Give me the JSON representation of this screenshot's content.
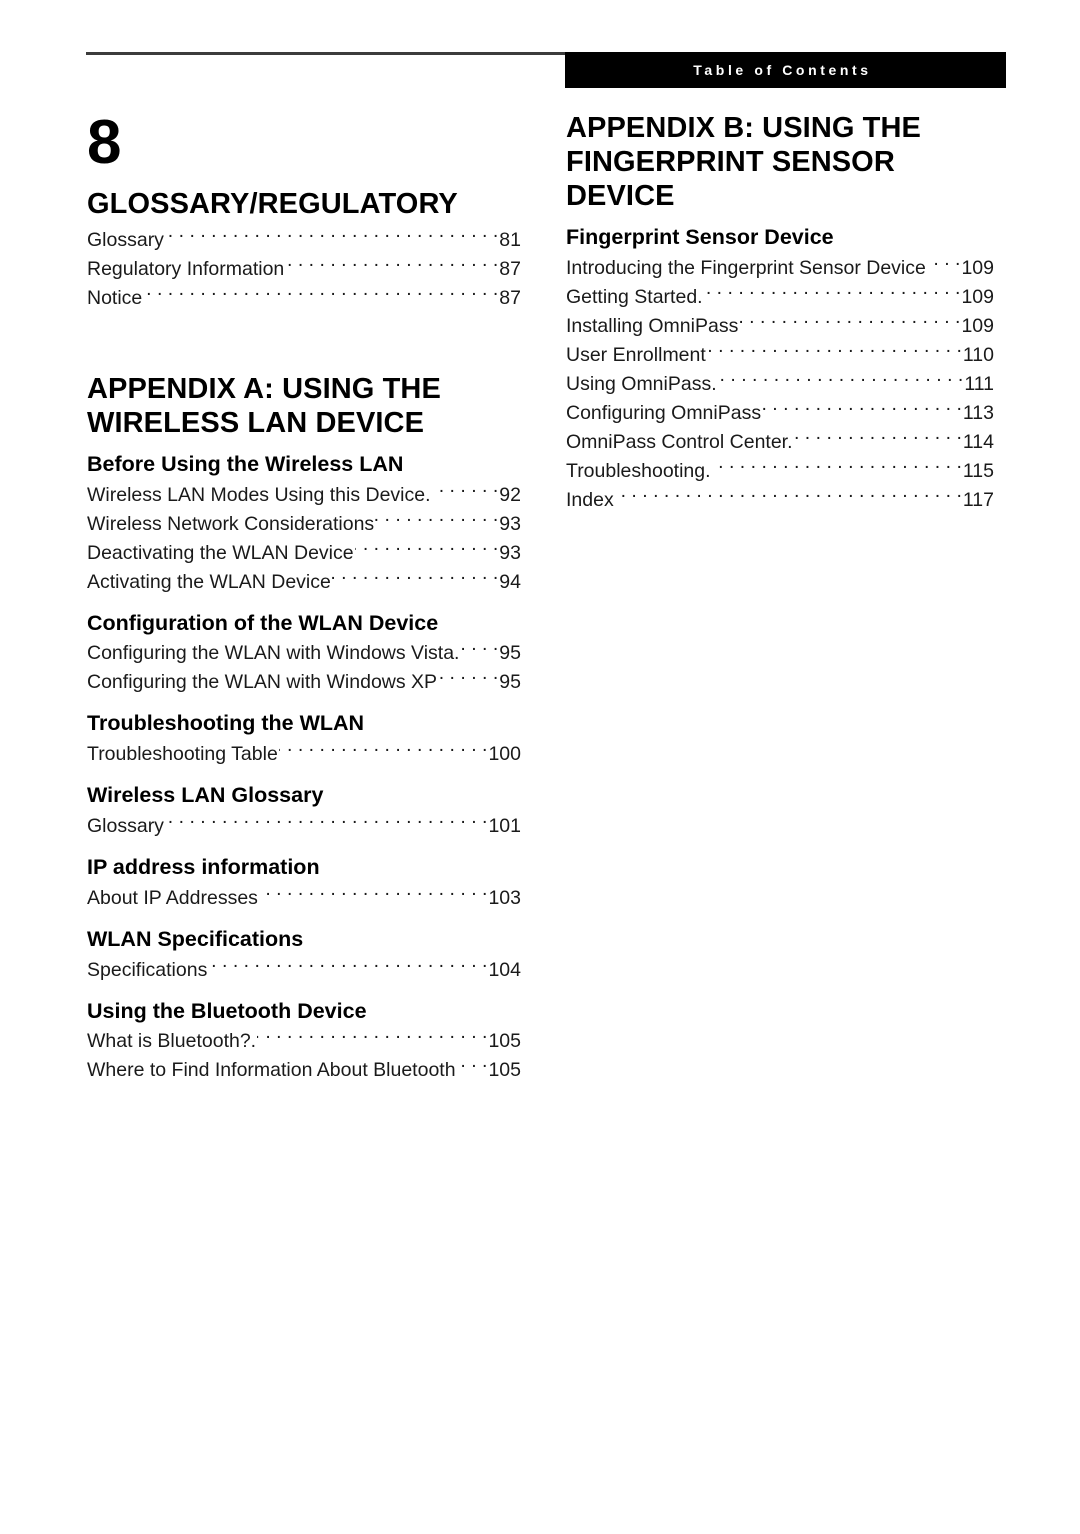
{
  "header": {
    "running_head": "Table of Contents"
  },
  "left_column": {
    "chapter_number": "8",
    "part_title": "GLOSSARY/REGULATORY",
    "entries": [
      {
        "label": "Glossary",
        "page": "81"
      },
      {
        "label": "Regulatory Information",
        "page": "87"
      },
      {
        "label": "Notice",
        "page": "87"
      }
    ],
    "appendix_a": {
      "title": "APPENDIX A: USING THE WIRELESS LAN DEVICE",
      "sections": [
        {
          "heading": "Before Using the Wireless LAN",
          "entries": [
            {
              "label": "Wireless LAN Modes Using this Device.",
              "page": "92"
            },
            {
              "label": "Wireless Network Considerations",
              "page": "93"
            },
            {
              "label": "Deactivating the WLAN Device",
              "page": "93"
            },
            {
              "label": "Activating the WLAN Device",
              "page": "94"
            }
          ]
        },
        {
          "heading": "Configuration of the WLAN Device",
          "entries": [
            {
              "label": "Configuring the WLAN with Windows Vista.",
              "page": "95"
            },
            {
              "label": "Configuring the WLAN with Windows XP",
              "page": "95"
            }
          ]
        },
        {
          "heading": "Troubleshooting the WLAN",
          "entries": [
            {
              "label": "Troubleshooting Table",
              "page": "100"
            }
          ]
        },
        {
          "heading": "Wireless LAN Glossary",
          "entries": [
            {
              "label": "Glossary",
              "page": "101"
            }
          ]
        },
        {
          "heading": "IP address information",
          "entries": [
            {
              "label": "About IP Addresses",
              "page": "103"
            }
          ]
        },
        {
          "heading": "WLAN Specifications",
          "entries": [
            {
              "label": "Specifications",
              "page": "104"
            }
          ]
        },
        {
          "heading": "Using the Bluetooth Device",
          "entries": [
            {
              "label": "What is Bluetooth?.",
              "page": "105"
            },
            {
              "label": "Where to Find Information About Bluetooth",
              "page": "105"
            }
          ]
        }
      ]
    }
  },
  "right_column": {
    "appendix_b": {
      "title": "APPENDIX B: USING THE FINGERPRINT SENSOR DEVICE",
      "sections": [
        {
          "heading": "Fingerprint Sensor Device",
          "entries": [
            {
              "label": "Introducing the Fingerprint Sensor Device",
              "page": "109"
            },
            {
              "label": "Getting Started.",
              "page": "109"
            },
            {
              "label": "Installing OmniPass",
              "page": "109"
            },
            {
              "label": "User Enrollment",
              "page": "110"
            },
            {
              "label": "Using OmniPass.",
              "page": "111"
            },
            {
              "label": "Configuring OmniPass",
              "page": "113"
            },
            {
              "label": "OmniPass Control Center.",
              "page": "114"
            },
            {
              "label": "Troubleshooting.",
              "page": "115"
            },
            {
              "label": "Index",
              "page": "117"
            }
          ]
        }
      ]
    }
  }
}
